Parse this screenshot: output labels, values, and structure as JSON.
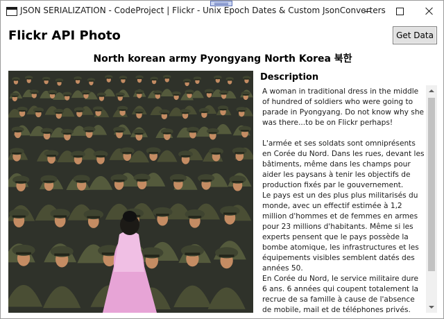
{
  "window": {
    "title": "JSON SERIALIZATION - CodeProject | Flickr - Unix Epoch Dates & Custom JsonConverters"
  },
  "header": {
    "title": "Flickr API Photo",
    "get_data_label": "Get Data"
  },
  "photo": {
    "title": "North korean army Pyongyang North Korea 북한"
  },
  "description": {
    "label": "Description",
    "text": "A woman in traditional dress in the middle of hundred of soldiers who were going to parade in Pyongyang. Do not know why she was there...to be on Flickr perhaps!\n\nL'armée et ses soldats sont omniprésents en Corée du Nord. Dans les rues, devant les bâtiments, même dans les champs pour aider les paysans à tenir les objectifs de production fixés par le gouvernement.\nLe pays est un des plus plus militarisés du monde, avec un effectif estimée à 1,2 million d'hommes et de femmes en armes pour 23 millions d'habitants. Même si les experts pensent que le pays possède la bombe atomique, les infrastructures et les équipements visibles semblent datés des années 50.\nEn Corée du Nord, le service militaire dure 6 ans. 6 années qui coupent totalement la recrue de sa famille à cause de l'absence de mobile, mail et de téléphones privés."
  },
  "icons": {
    "app": "window-app-icon",
    "minimize": "minimize-icon",
    "maximize": "maximize-icon",
    "close": "close-icon",
    "scroll_up": "scroll-up-arrow-icon",
    "scroll_down": "scroll-down-arrow-icon"
  },
  "colors": {
    "dress": "#e7a4d6",
    "uniform": "#4a4e34",
    "cap": "#3f4430",
    "face": "#c48c63",
    "background": "#2f322a"
  }
}
